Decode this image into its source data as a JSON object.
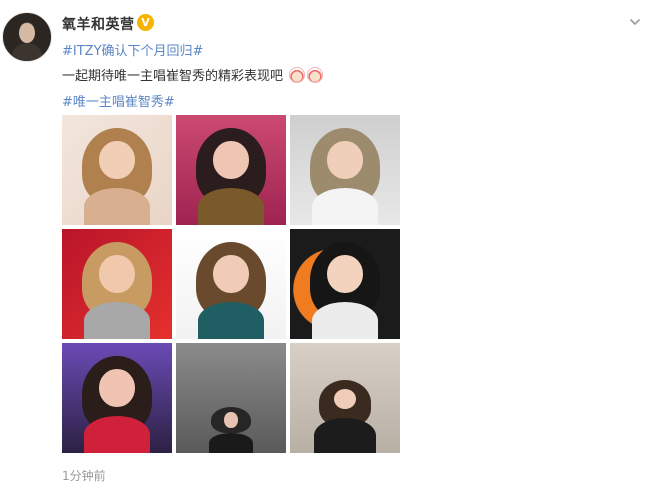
{
  "post": {
    "author": {
      "name": "氧羊和英营",
      "verified_symbol": "V",
      "avatar_icon": "user-avatar"
    },
    "hashtag_top": "#ITZY确认下个月回归#",
    "text": "一起期待唯一主唱崔智秀的精彩表现吧",
    "emojis": [
      "heart-face-emoji",
      "heart-face-emoji"
    ],
    "hashtag_bottom": "#唯一主唱崔智秀#",
    "images": [
      {
        "id": "photo-1"
      },
      {
        "id": "photo-2"
      },
      {
        "id": "photo-3"
      },
      {
        "id": "photo-4"
      },
      {
        "id": "photo-5"
      },
      {
        "id": "photo-6"
      },
      {
        "id": "photo-7"
      },
      {
        "id": "photo-8"
      },
      {
        "id": "photo-9"
      }
    ],
    "time": "1分钟前"
  },
  "colors": {
    "link": "#5b86c6",
    "verified": "#f6b300",
    "text": "#333333",
    "muted": "#999999"
  },
  "icons": {
    "verified": "verified-badge-icon",
    "more": "chevron-down-icon"
  }
}
